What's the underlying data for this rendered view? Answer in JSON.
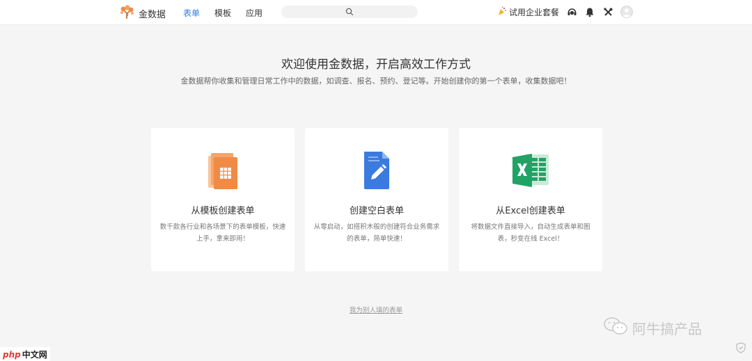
{
  "header": {
    "brand": "金数据",
    "nav": [
      "表单",
      "模板",
      "应用"
    ],
    "trial_label": "试用企业套餐"
  },
  "hero": {
    "title": "欢迎使用金数据，开启高效工作方式",
    "subtitle": "金数据帮你收集和管理日常工作中的数据，如调查、报名、预约、登记等。开始创建你的第一个表单，收集数据吧！"
  },
  "cards": [
    {
      "title": "从模板创建表单",
      "desc": "数千款各行业和各场景下的表单模板，快速上手，拿来即用！",
      "icon": "template-icon"
    },
    {
      "title": "创建空白表单",
      "desc": "从零启动，如搭积木般的创建符合业务需求的表单，简单快速！",
      "icon": "document-icon"
    },
    {
      "title": "从Excel创建表单",
      "desc": "将数据文件直接导入，自动生成表单和图表，秒变在线 Excel！",
      "icon": "excel-icon"
    }
  ],
  "bottom_link": "我为别人填的表单",
  "watermark": "阿牛搞产品",
  "badge": {
    "php": "php",
    "cn": "中文网"
  },
  "colors": {
    "accent": "#2f7ce6",
    "orange": "#f08b45",
    "blue_doc": "#3b7be0",
    "excel_green": "#21a366"
  }
}
